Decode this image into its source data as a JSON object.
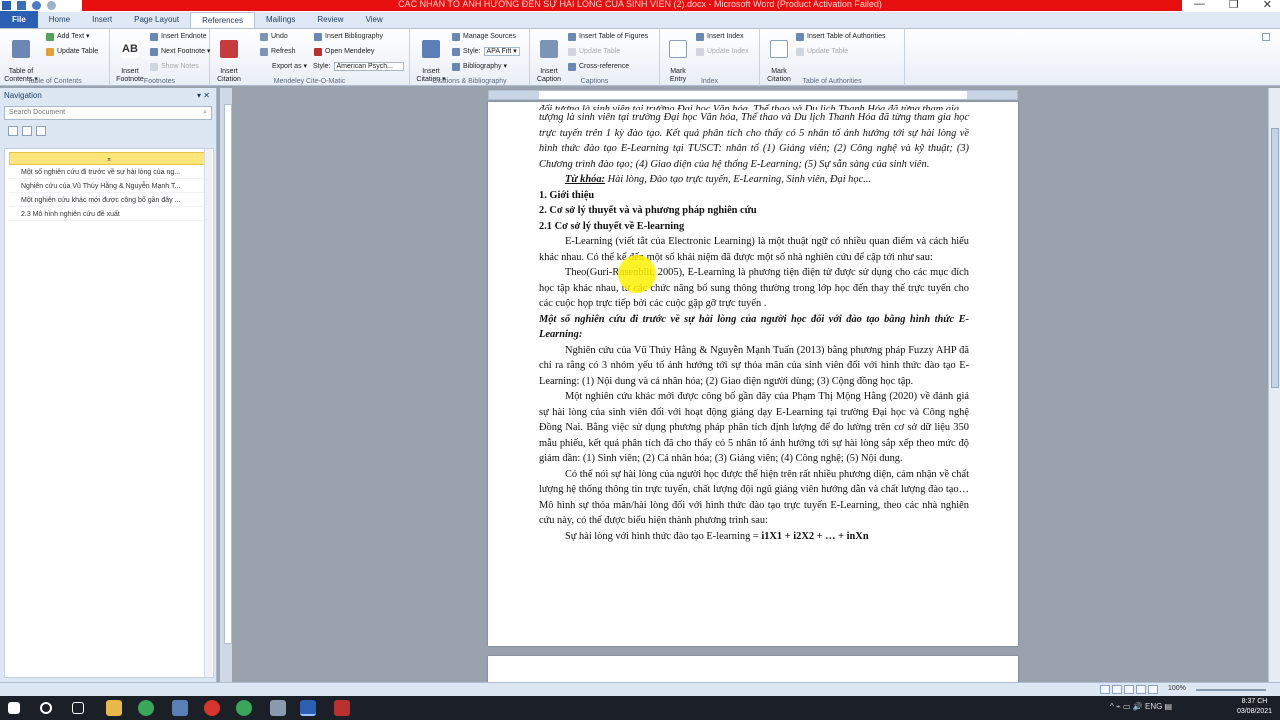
{
  "window": {
    "title": "CÁC NHÂN TỐ ẢNH HƯỞNG ĐẾN SỰ HÀI LÒNG CỦA SINH VIÊN (2).docx - Microsoft Word (Product Activation Failed)",
    "controls": [
      "—",
      "❐",
      "✕"
    ]
  },
  "tabs": [
    "File",
    "Home",
    "Insert",
    "Page Layout",
    "References",
    "Mailings",
    "Review",
    "View"
  ],
  "ribbon": {
    "toc": {
      "big": "Table of\nContents ▾",
      "add_text": "Add Text ▾",
      "update_table": "Update Table",
      "label": "Table of Contents"
    },
    "footnotes": {
      "big": "Insert\nFootnote",
      "insert_endnote": "Insert Endnote",
      "next_footnote": "Next Footnote ▾",
      "show_notes": "Show Notes",
      "label": "Footnotes"
    },
    "mendeley": {
      "big": "Insert\nCitation",
      "undo": "Undo",
      "refresh": "Refresh",
      "export_as": "Export as ▾",
      "insert_bibliography": "Insert Bibliography",
      "open_mendeley": "Open Mendeley",
      "style_label": "Style:",
      "style_value": "American Psych...",
      "label": "Mendeley Cite-O-Matic"
    },
    "citations": {
      "big": "Insert\nCitation ▾",
      "manage_sources": "Manage Sources",
      "style_label": "Style:",
      "style_value": "APA Fift ▾",
      "bibliography": "Bibliography ▾",
      "label": "Citations & Bibliography"
    },
    "captions": {
      "big": "Insert\nCaption",
      "insert_tof": "Insert Table of Figures",
      "update_table": "Update Table",
      "cross_reference": "Cross-reference",
      "label": "Captions"
    },
    "index": {
      "big": "Mark\nEntry",
      "insert_index": "Insert Index",
      "update_index": "Update Index",
      "label": "Index"
    },
    "toa": {
      "big": "Mark\nCitation",
      "insert_toa": "Insert Table of Authorities",
      "update_table": "Update Table",
      "label": "Table of Authorities"
    }
  },
  "navigation": {
    "title": "Navigation",
    "close": "▾ ✕",
    "search_placeholder": "Search Document",
    "selected_marker": "⌅",
    "items": [
      "Một số nghiên cứu đi trước về sự hài lòng của ng...",
      "Nghiên cứu của Vũ Thúy Hằng & Nguyễn Mạnh T...",
      "Một nghiên cứu khác mới được công bố gần đây ...",
      "2.3 Mô hình nghiên cứu đề xuất"
    ]
  },
  "document": {
    "p0": "đối tượng là sinh viên tại trường Đại học Văn hóa, Thể thao và Du lịch Thanh Hóa đã từng tham gia",
    "p1": "tượng là sinh viên tại trường Đại học Văn hóa, Thể thao và Du lịch Thanh Hóa đã từng tham gia học trực tuyến trên 1 kỳ đào tạo. Kết quả phân tích cho thấy có 5 nhân tố ảnh hưởng tới sự hài lòng về hình thức đào tạo E-Learning tại TUSCT: nhân tố (1) Giảng viên; (2) Công nghệ và kỹ thuật; (3) Chương trình đào tạo; (4) Giao diện của hệ thống E-Learning; (5) Sự sẵn sàng của sinh viên.",
    "kw_label": "Từ khóa:",
    "kw_text": " Hài lòng, Đào tạo trực tuyến, E-Learning, Sinh viên, Đại học...",
    "h1": "1. Giới thiệu",
    "h2": "2. Cơ sở lý thuyết và và phương pháp nghiên cứu",
    "h21": "2.1 Cơ sở lý thuyết về E-learning",
    "para1": "E-Learning (viết tắt của Electronic Learning) là một thuật ngữ có nhiều quan điểm và cách hiểu khác nhau. Có thể kể đến một số khái niệm đã được một số nhà nghiên cứu để cập tới như sau:",
    "para2": "Theo(Guri-Rosenblit, 2005), E-Learning là phương tiện điện tử được sử dụng cho các mục đích học tập khác nhau, từ các chức năng bổ sung thông thường trong lớp học đến thay thế trực tuyến cho các cuộc họp trực tiếp bởi các cuộc gặp gỡ trực tuyến .",
    "h_bi": "Một số nghiên cứu đi trước về sự hài lòng của người học đối với đào tạo bằng hình thức E-Learning:",
    "para3": "Nghiên cứu của Vũ Thúy Hằng & Nguyễn Mạnh Tuấn (2013) bằng phương pháp Fuzzy AHP đã chỉ ra rằng có 3 nhóm yếu tố ảnh hưởng tới sự thỏa mãn của sinh viên đối với hình thức đào tạo E-Learning: (1) Nội dung và cá nhân hóa; (2) Giao diện người dùng; (3) Cộng đồng học tập.",
    "para4": "Một nghiên cứu khác mới được công bố gần đây của Phạm Thị Mộng Hằng (2020) về đánh giá sự hài lòng của sinh viên đối với hoạt động giảng dạy E-Learning tại trường Đại học và Công nghệ Đồng Nai. Bằng việc sử dụng phương pháp phân tích định lượng để đo lường trên cơ sở dữ liệu 350 mẫu phiếu, kết quả phân tích đã cho thấy có 5 nhân tố ảnh hưởng tới sự hài lòng sắp xếp theo mức độ giảm dần: (1) Sinh viên; (2) Cá nhân hóa; (3) Giảng viên; (4) Công nghệ; (5) Nội dung.",
    "para5": "Có thể nói sự hài lòng của người học được thể hiện trên rất nhiều phương diện, cảm nhận về chất lượng hệ thống thông tin trực tuyến, chất lượng đội ngũ giảng viên hướng dẫn và chất lượng đào tạo… Mô hình sự thỏa mãn/hài lòng đối với hình thức đào tạo trực tuyến E-Learning, theo các nhà nghiên cứu này, có thể được biểu hiện thành phương trình sau:",
    "formula_a": "Sự hài lòng với hình thức đào tạo E-learning = ",
    "formula_b": "i1X1 + i2X2 + … + inXn"
  },
  "status": {
    "zoom": "100%",
    "minus": "−",
    "plus": "+"
  },
  "taskbar": {
    "time": "8:37 CH",
    "date": "03/08/2021",
    "tray": "^ ⌁ ▭ 🔊 ENG ▤"
  },
  "colors": {
    "title_red": "#e8100f",
    "file_tab": "#2b5fb4",
    "nav_selected": "#fde579",
    "taskbar": "#1b1f26"
  }
}
